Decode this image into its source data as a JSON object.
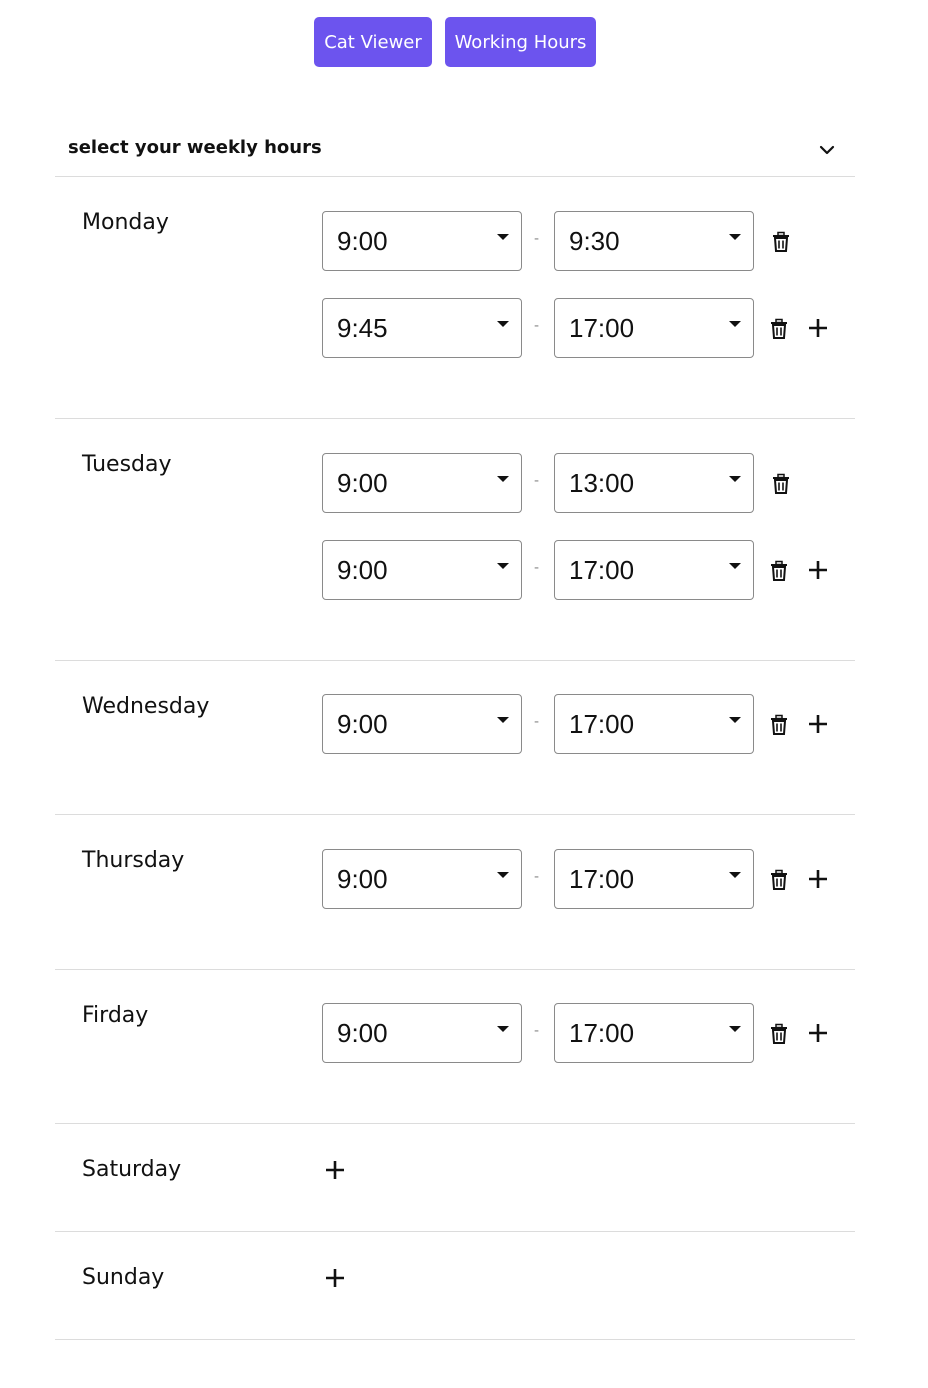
{
  "nav": {
    "cat_viewer": "Cat Viewer",
    "working_hours": "Working Hours"
  },
  "header": {
    "title": "select your weekly hours",
    "toggle_icon": "chevron-down-icon"
  },
  "separator": "-",
  "days": [
    {
      "name": "Monday",
      "slots": [
        {
          "start": "9:00",
          "end": "9:30"
        },
        {
          "start": "9:45",
          "end": "17:00"
        }
      ]
    },
    {
      "name": "Tuesday",
      "slots": [
        {
          "start": "9:00",
          "end": "13:00"
        },
        {
          "start": "9:00",
          "end": "17:00"
        }
      ]
    },
    {
      "name": "Wednesday",
      "slots": [
        {
          "start": "9:00",
          "end": "17:00"
        }
      ]
    },
    {
      "name": "Thursday",
      "slots": [
        {
          "start": "9:00",
          "end": "17:00"
        }
      ]
    },
    {
      "name": "Firday",
      "slots": [
        {
          "start": "9:00",
          "end": "17:00"
        }
      ]
    },
    {
      "name": "Saturday",
      "slots": []
    },
    {
      "name": "Sunday",
      "slots": []
    }
  ],
  "colors": {
    "accent": "#6c54ee",
    "divider": "#dcdcdc"
  }
}
